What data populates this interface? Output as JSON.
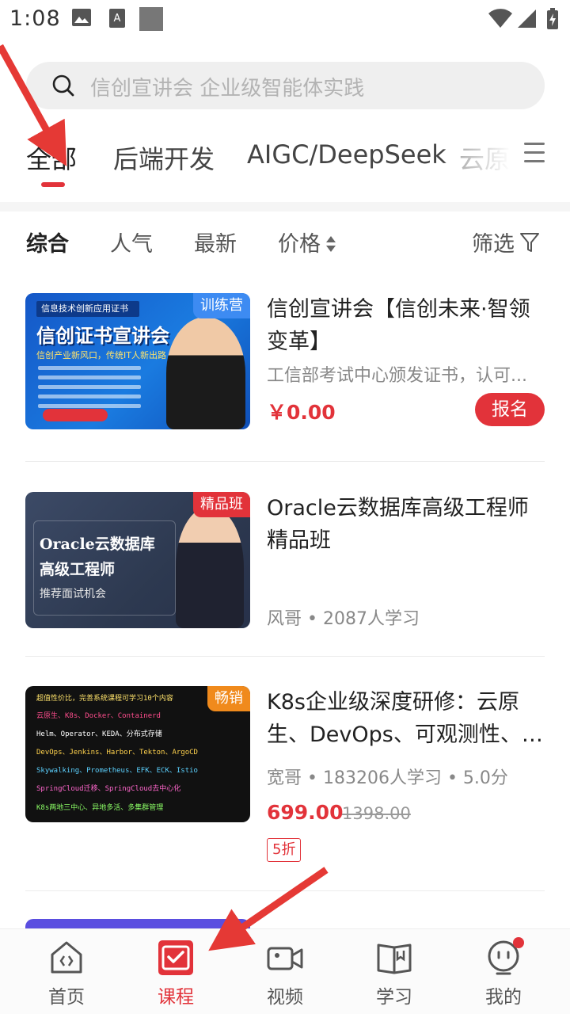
{
  "status_bar": {
    "time": "1:08"
  },
  "search": {
    "placeholder": "信创宣讲会 企业级智能体实践"
  },
  "category_tabs": [
    {
      "label": "全部",
      "active": true
    },
    {
      "label": "后端开发"
    },
    {
      "label": "AIGC/DeepSeek"
    },
    {
      "label": "云原"
    }
  ],
  "sort_bar": {
    "items": [
      "综合",
      "人气",
      "最新",
      "价格"
    ],
    "active": "综合",
    "filter_label": "筛选"
  },
  "courses": [
    {
      "title": "信创宣讲会【信创未来·智领变革】",
      "subtitle": "工信部考试中心颁发证书，认可...",
      "price": "￥0.00",
      "button": "报名",
      "tag": "训练营",
      "tag_color": "#3d8bf2",
      "thumb": {
        "badge": "信息技术创新应用证书",
        "headline": "信创证书宣讲会",
        "subline": "信创产业新风口，传统IT人新出路"
      }
    },
    {
      "title": "Oracle云数据库高级工程师精品班",
      "meta": "风哥 • 2087人学习",
      "tag": "精品班",
      "tag_color": "#e2333a",
      "thumb": {
        "line1": "Oracle云数据库",
        "line2": "高级工程师",
        "line3": "推荐面试机会"
      }
    },
    {
      "title": "K8s企业级深度研修：云原生、DevOps、可观测性、…",
      "meta": "宽哥 • 183206人学习 • 5.0分",
      "price": "699.00",
      "original_price": "1398.00",
      "discount": "5折",
      "tag": "畅销",
      "tag_color": "#f08a1c",
      "thumb": {
        "lines": [
          "超值性价比，完善系统课程可学习10个内容",
          "云原生、K8s、Docker、Containerd",
          "Helm、Operator、KEDA、分布式存储",
          "DevOps、Jenkins、Harbor、Tekton、ArgoCD",
          "Skywalking、Prometheus、EFK、ECK、Istio",
          "SpringCloud迁移、SpringCloud去中心化",
          "K8s两地三中心、异地多活、多集群管理"
        ]
      }
    }
  ],
  "bottom_nav": [
    {
      "label": "首页",
      "icon": "home-icon"
    },
    {
      "label": "课程",
      "icon": "course-icon",
      "active": true
    },
    {
      "label": "视频",
      "icon": "video-icon"
    },
    {
      "label": "学习",
      "icon": "book-icon"
    },
    {
      "label": "我的",
      "icon": "profile-icon",
      "badge_dot": true
    }
  ],
  "colors": {
    "accent": "#e2333a",
    "annotation_arrow": "#e53935"
  }
}
